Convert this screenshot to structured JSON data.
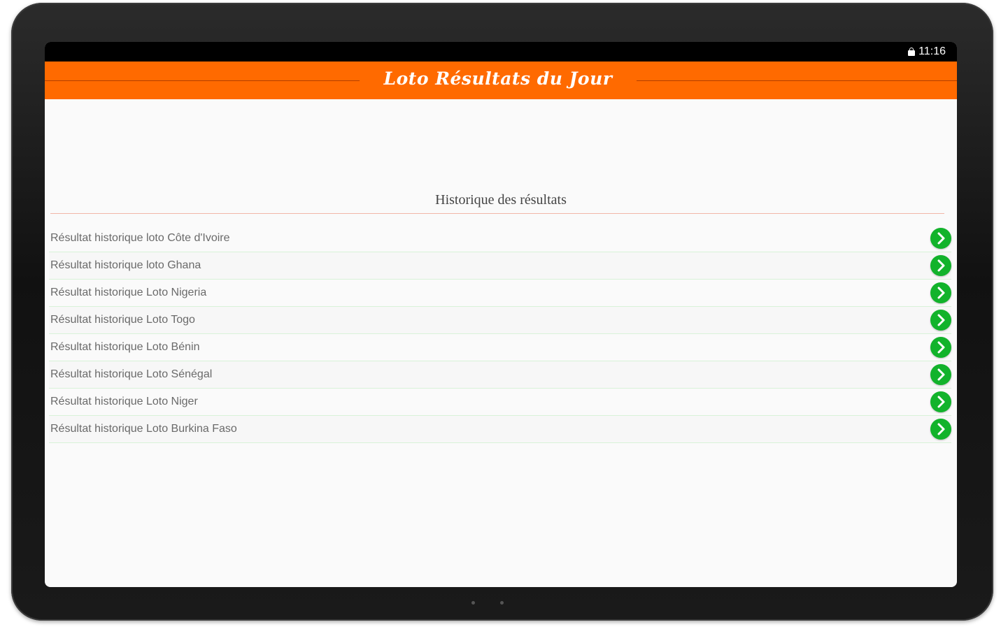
{
  "status_bar": {
    "time": "11:16",
    "icons": [
      "lock-icon"
    ]
  },
  "header": {
    "title": "Loto Résultats du Jour",
    "background_color": "#ff6a00"
  },
  "history": {
    "title": "Historique des résultats",
    "items": [
      {
        "label": "Résultat historique loto Côte d'Ivoire",
        "icon": "chevron-right-icon"
      },
      {
        "label": "Résultat historique loto Ghana",
        "icon": "chevron-right-icon"
      },
      {
        "label": "Résultat historique Loto Nigeria",
        "icon": "chevron-right-icon"
      },
      {
        "label": "Résultat historique Loto Togo",
        "icon": "chevron-right-icon"
      },
      {
        "label": "Résultat historique Loto Bénin",
        "icon": "chevron-right-icon"
      },
      {
        "label": "Résultat historique Loto Sénégal",
        "icon": "chevron-right-icon"
      },
      {
        "label": "Résultat historique Loto Niger",
        "icon": "chevron-right-icon"
      },
      {
        "label": "Résultat historique Loto Burkina Faso",
        "icon": "chevron-right-icon"
      }
    ]
  },
  "colors": {
    "accent_orange": "#ff6a00",
    "chevron_green": "#12b32b",
    "row_divider": "#d8f2d8"
  }
}
